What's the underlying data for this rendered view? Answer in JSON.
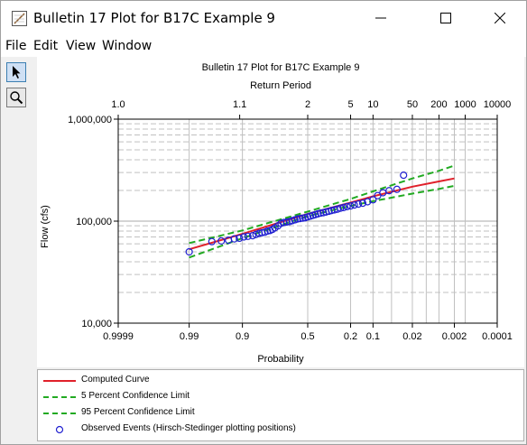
{
  "window": {
    "title": "Bulletin 17 Plot for B17C Example 9",
    "minimize_glyph": "—",
    "maximize_glyph": "☐",
    "close_glyph": "✕"
  },
  "menu": [
    "File",
    "Edit",
    "View",
    "Window"
  ],
  "toolbar": {
    "tools": [
      {
        "icon": "pointer-arrow-icon"
      },
      {
        "icon": "magnifier-zoom-icon"
      }
    ]
  },
  "colors": {
    "computed": "#e0202a",
    "confidence": "#22aa22",
    "observed": "#2020d0",
    "grid": "#c0c0c0"
  },
  "chart_data": {
    "type": "scatter",
    "title": "Bulletin 17 Plot for B17C Example 9",
    "top_axis_label": "Return Period",
    "xlabel": "Probability",
    "ylabel": "Flow (cfs)",
    "x_scale": "normal-probability (exceedance, decreasing left to right)",
    "y_scale": "log",
    "xlim": [
      0.9999,
      0.0001
    ],
    "ylim": [
      10000,
      1000000
    ],
    "grid": true,
    "legend_position": "bottom",
    "x_ticks": [
      "0.9999",
      "0.99",
      "0.9",
      "0.5",
      "0.2",
      "0.1",
      "0.02",
      "0.002",
      "0.0001"
    ],
    "top_ticks": [
      "1.0",
      "1.1",
      "2",
      "5",
      "10",
      "50",
      "200",
      "1000",
      "10000"
    ],
    "y_ticks": [
      "10,000",
      "100,000",
      "1,000,000"
    ],
    "series": [
      {
        "name": "Computed Curve",
        "style": "solid",
        "x": [
          0.99,
          0.9,
          0.5,
          0.2,
          0.1,
          0.02,
          0.005,
          0.002
        ],
        "y": [
          53000,
          75000,
          118000,
          152000,
          175000,
          218000,
          245000,
          262000
        ]
      },
      {
        "name": "5 Percent Confidence Limit",
        "style": "dashed",
        "x": [
          0.99,
          0.9,
          0.5,
          0.2,
          0.1,
          0.02,
          0.005,
          0.002
        ],
        "y": [
          61000,
          81000,
          124000,
          165000,
          196000,
          262000,
          312000,
          350000
        ]
      },
      {
        "name": "95 Percent Confidence Limit",
        "style": "dashed",
        "x": [
          0.99,
          0.9,
          0.5,
          0.2,
          0.1,
          0.02,
          0.005,
          0.002
        ],
        "y": [
          44000,
          68000,
          112000,
          141000,
          157000,
          186000,
          207000,
          222000
        ]
      },
      {
        "name": "Observed Events (Hirsch-Stedinger plotting positions)",
        "style": "circle-markers",
        "x": [
          0.99,
          0.97,
          0.955,
          0.94,
          0.925,
          0.91,
          0.895,
          0.88,
          0.86,
          0.845,
          0.83,
          0.815,
          0.8,
          0.785,
          0.77,
          0.755,
          0.74,
          0.72,
          0.7,
          0.68,
          0.66,
          0.64,
          0.62,
          0.6,
          0.58,
          0.56,
          0.54,
          0.52,
          0.5,
          0.48,
          0.46,
          0.44,
          0.42,
          0.4,
          0.38,
          0.36,
          0.34,
          0.32,
          0.3,
          0.28,
          0.26,
          0.24,
          0.22,
          0.2,
          0.18,
          0.16,
          0.14,
          0.12,
          0.1,
          0.085,
          0.07,
          0.055,
          0.04,
          0.03
        ],
        "y": [
          50000,
          63000,
          64000,
          65000,
          67000,
          68000,
          70000,
          71000,
          72000,
          74000,
          76000,
          77000,
          78000,
          80000,
          81000,
          83000,
          86000,
          90000,
          95000,
          97000,
          98000,
          99000,
          101000,
          103000,
          105000,
          106000,
          107000,
          108000,
          110000,
          112000,
          114000,
          116000,
          118000,
          120000,
          121000,
          123000,
          125000,
          127000,
          129000,
          131000,
          134000,
          136000,
          139000,
          141000,
          144000,
          147000,
          150000,
          155000,
          162000,
          178000,
          190000,
          199000,
          205000,
          282000
        ]
      }
    ]
  }
}
